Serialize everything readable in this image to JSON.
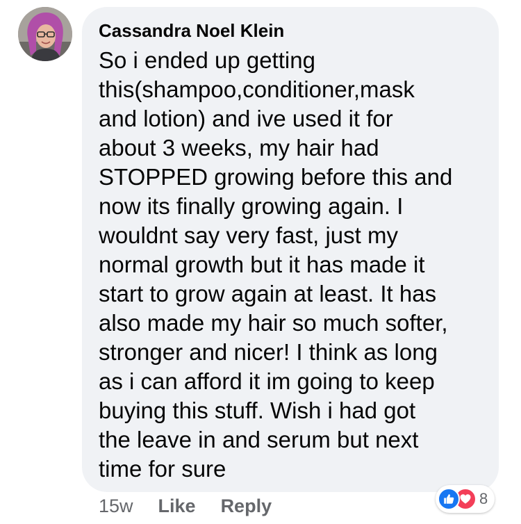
{
  "comment": {
    "author": "Cassandra Noel Klein",
    "lines": [
      "So i ended up getting",
      "this(shampoo,conditioner,mask",
      "and lotion) and ive used it for",
      "about 3 weeks, my hair had",
      "STOPPED growing before this and",
      "now its finally growing again. I",
      "wouldnt say very fast, just my",
      "normal growth but it has made it",
      "start to grow again at least. It has",
      "also made my hair so much softer,",
      "stronger and nicer! I think as long",
      "as i can afford it im going to keep",
      "buying this stuff. Wish i had got",
      "the leave in and serum but next",
      "time for sure"
    ],
    "timestamp": "15w",
    "like_label": "Like",
    "reply_label": "Reply",
    "reaction_count": "8",
    "reaction_icons": [
      "like-icon",
      "love-icon"
    ],
    "avatar_icon": "profile-photo"
  },
  "colors": {
    "bubble_bg": "#f0f2f5",
    "text": "#050505",
    "meta": "#65676b",
    "like_blue": "#1877f2",
    "love_red": "#f33e58"
  }
}
